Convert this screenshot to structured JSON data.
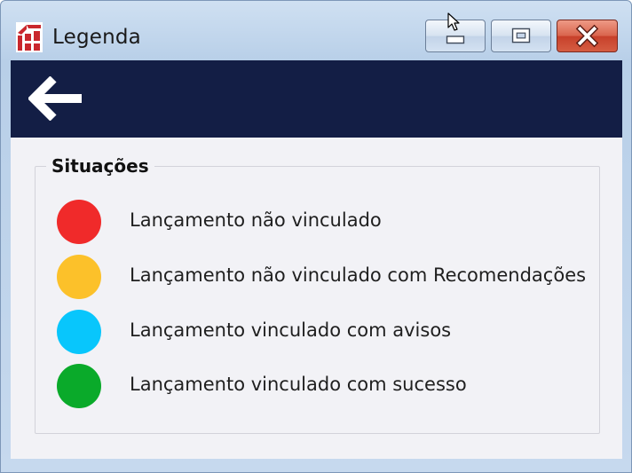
{
  "window": {
    "title": "Legenda"
  },
  "controls": {
    "minimize_icon": "minimize-icon",
    "maximize_icon": "maximize-icon",
    "close_icon": "close-icon"
  },
  "header": {
    "back_icon": "arrow-left-icon",
    "background": "#131e45"
  },
  "group": {
    "title": "Situações",
    "items": [
      {
        "label": "Lançamento não vinculado",
        "color": "#f02a2a"
      },
      {
        "label": "Lançamento não vinculado com Recomendações",
        "color": "#fcc12a"
      },
      {
        "label": "Lançamento vinculado com avisos",
        "color": "#08c6fc"
      },
      {
        "label": "Lançamento vinculado com sucesso",
        "color": "#0aaa2a"
      }
    ]
  }
}
